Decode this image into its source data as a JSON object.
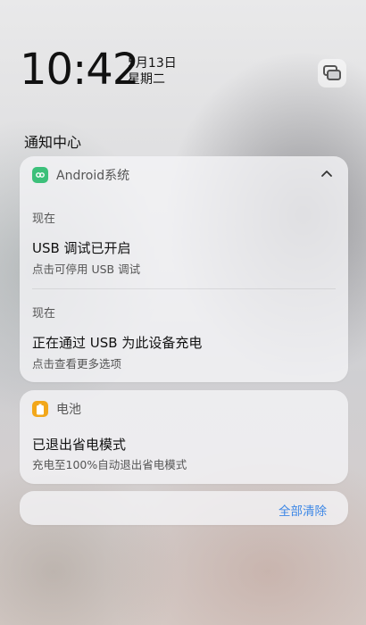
{
  "status": {
    "time": "10:42",
    "date": "5月13日",
    "weekday": "星期二",
    "header_icon": "notification-manage-icon"
  },
  "notification_center": {
    "title": "通知中心"
  },
  "android_group": {
    "app_name": "Android系统",
    "app_icon": "android-system-icon",
    "accent": "#3cc07a",
    "notifications": [
      {
        "time": "现在",
        "title": "USB 调试已开启",
        "subtitle": "点击可停用 USB 调试"
      },
      {
        "time": "现在",
        "title": "正在通过 USB 为此设备充电",
        "subtitle": "点击查看更多选项"
      }
    ]
  },
  "battery_group": {
    "app_name": "电池",
    "app_icon": "battery-icon",
    "accent": "#f2a71a",
    "notification": {
      "title": "已退出省电模式",
      "subtitle": "充电至100%自动退出省电模式"
    }
  },
  "actions": {
    "clear_all": "全部清除"
  }
}
